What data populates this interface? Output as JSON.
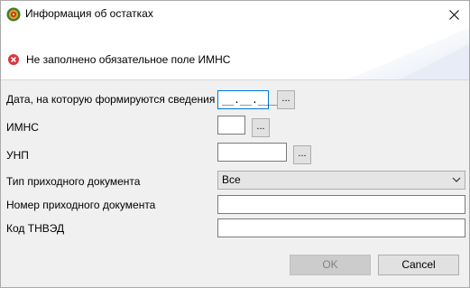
{
  "window": {
    "title": "Информация об остатках",
    "close_glyph": "✕"
  },
  "banner": {
    "error_message": "Не заполнено обязательное поле ИМНС",
    "icon": "error-icon"
  },
  "form": {
    "date": {
      "label": "Дата, на которую формируются сведения",
      "value": "__.__.____",
      "button_label": "..."
    },
    "imns": {
      "label": "ИМНС",
      "value": "",
      "button_label": "..."
    },
    "unp": {
      "label": "УНП",
      "value": "",
      "button_label": "..."
    },
    "doc_type": {
      "label": "Тип приходного документа",
      "selected": "Все"
    },
    "doc_number": {
      "label": "Номер приходного документа",
      "value": ""
    },
    "tnved": {
      "label": "Код ТНВЭД",
      "value": ""
    }
  },
  "buttons": {
    "ok": "OK",
    "cancel": "Cancel"
  },
  "colors": {
    "accent": "#0078d7",
    "error": "#d9363e",
    "app_icon_outer": "#3c7a2e",
    "app_icon_inner": "#e0a020"
  }
}
